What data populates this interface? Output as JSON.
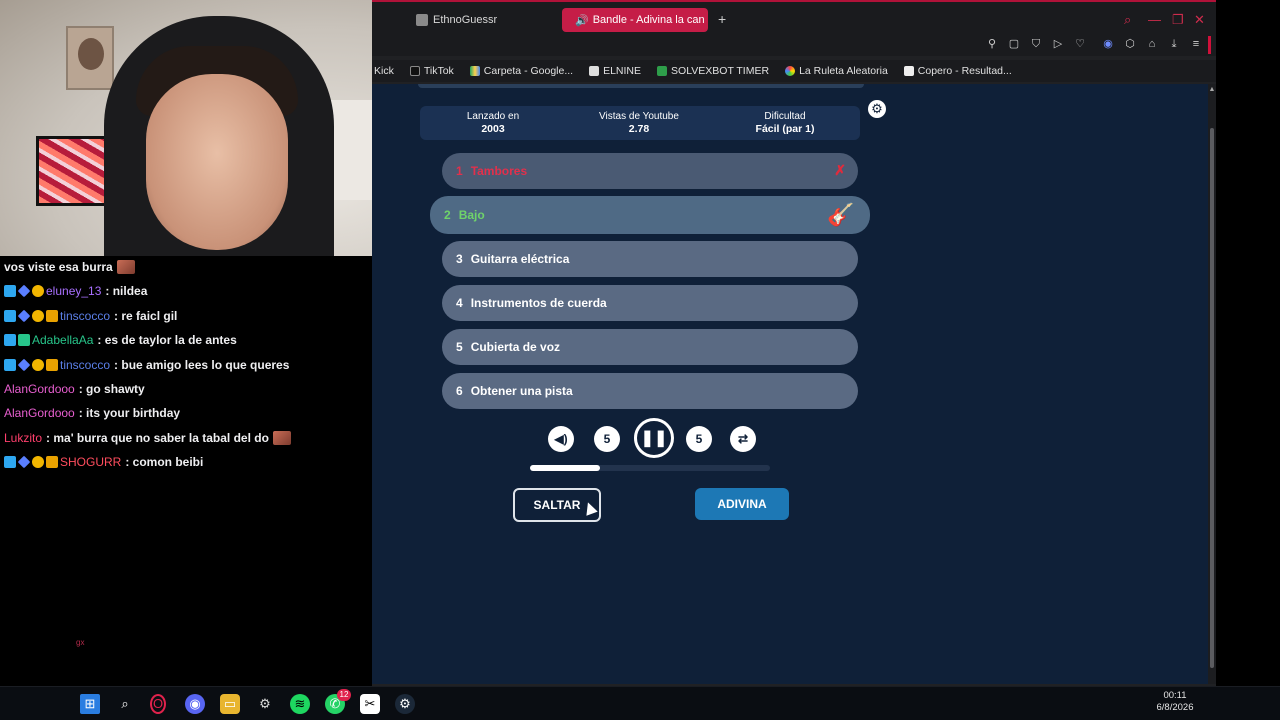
{
  "browser": {
    "tabs": [
      {
        "label": "EthnoGuessr",
        "active": false
      },
      {
        "label": "Bandle - Adivina la can",
        "active": true
      }
    ],
    "new_tab": "+",
    "bookmarks": [
      "Kick",
      "TikTok",
      "Carpeta - Google...",
      "ELNINE",
      "SOLVEXBOT TIMER",
      "La Ruleta Aleatoria",
      "Copero - Resultad..."
    ]
  },
  "game": {
    "info": [
      {
        "label": "Lanzado en",
        "value": "2003"
      },
      {
        "label": "Vistas de Youtube",
        "value": "2.78"
      },
      {
        "label": "Dificultad",
        "value": "Fácil (par 1)"
      }
    ],
    "hints": [
      {
        "num": "1",
        "label": "Tambores",
        "state": "failed"
      },
      {
        "num": "2",
        "label": "Bajo",
        "state": "active"
      },
      {
        "num": "3",
        "label": "Guitarra eléctrica",
        "state": "locked"
      },
      {
        "num": "4",
        "label": "Instrumentos de cuerda",
        "state": "locked"
      },
      {
        "num": "5",
        "label": "Cubierta de voz",
        "state": "locked"
      },
      {
        "num": "6",
        "label": "Obtener una pista",
        "state": "locked"
      }
    ],
    "rewind_seconds": "5",
    "forward_seconds": "5",
    "progress": 0.29,
    "skip_label": "SALTAR",
    "guess_label": "ADIVINA"
  },
  "chat": [
    {
      "user": "",
      "text": "vos viste esa burra",
      "user_color": "#efeff1",
      "badges": [],
      "emote": true
    },
    {
      "user": "eluney_13",
      "text": ": nildea",
      "user_color": "#a970ff",
      "badges": [
        "blue",
        "cube",
        "coin"
      ],
      "emote": false
    },
    {
      "user": "tinscocco",
      "text": ": re faicl gil",
      "user_color": "#5b7fe8",
      "badges": [
        "blue",
        "cube",
        "coin",
        "mail"
      ],
      "emote": false
    },
    {
      "user": "AdabellaAa",
      "text": ": es de taylor la de antes",
      "user_color": "#27c58a",
      "badges": [
        "blue",
        "green"
      ],
      "emote": false
    },
    {
      "user": "tinscocco",
      "text": ": bue amigo lees lo que queres",
      "user_color": "#5b7fe8",
      "badges": [
        "blue",
        "cube",
        "coin",
        "mail"
      ],
      "emote": false
    },
    {
      "user": "AlanGordooo",
      "text": ": go shawty",
      "user_color": "#e85fd0",
      "badges": [],
      "emote": false
    },
    {
      "user": "AlanGordooo",
      "text": ": its your birthday",
      "user_color": "#e85fd0",
      "badges": [],
      "emote": false
    },
    {
      "user": "Lukzito",
      "text": ": ma' burra que no saber la tabal del do",
      "user_color": "#ff3f6c",
      "badges": [],
      "emote": true
    },
    {
      "user": "SHOGURR",
      "text": ": comon beibi",
      "user_color": "#ff4d5e",
      "badges": [
        "blue",
        "cube",
        "coin",
        "mail"
      ],
      "emote": false
    }
  ],
  "taskbar": {
    "time": "00:11",
    "date": "6/8/2026",
    "whatsapp_badge": "12"
  }
}
